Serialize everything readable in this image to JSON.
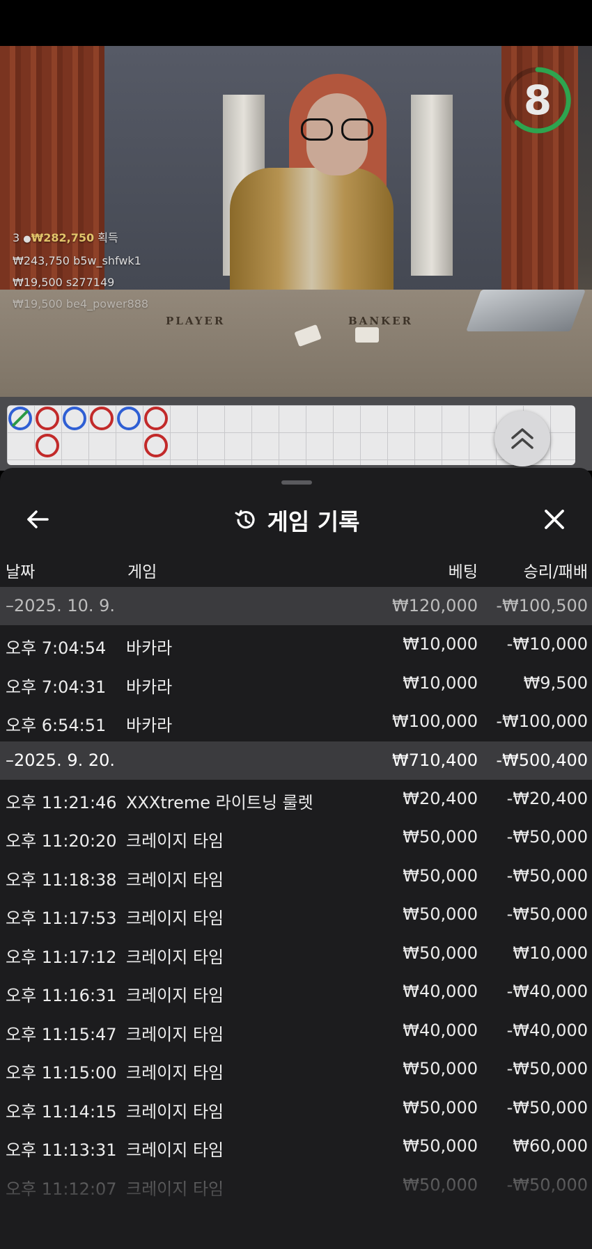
{
  "stream": {
    "timer_value": "8",
    "table_labels": {
      "player": "PLAYER",
      "banker": "BANKER"
    },
    "winners": {
      "summary": {
        "count": "3",
        "amount": "₩282,750",
        "suffix": "획득"
      },
      "entries": [
        {
          "amount": "₩243,750",
          "user": "b5w_shfwk1"
        },
        {
          "amount": "₩19,500",
          "user": "s277149"
        },
        {
          "amount": "₩19,500",
          "user": "be4_power888"
        }
      ]
    }
  },
  "roadmap": {
    "beads": [
      {
        "color": "blue",
        "col": 0,
        "row": 0,
        "marked": true
      },
      {
        "color": "red",
        "col": 1,
        "row": 0,
        "marked": false
      },
      {
        "color": "red",
        "col": 1,
        "row": 1,
        "marked": false
      },
      {
        "color": "blue",
        "col": 2,
        "row": 0,
        "marked": false
      },
      {
        "color": "red",
        "col": 3,
        "row": 0,
        "marked": false
      },
      {
        "color": "blue",
        "col": 4,
        "row": 0,
        "marked": false
      },
      {
        "color": "red",
        "col": 5,
        "row": 0,
        "marked": false
      },
      {
        "color": "red",
        "col": 5,
        "row": 1,
        "marked": false
      }
    ],
    "expand_icon": "double-chevron-up-icon"
  },
  "sheet": {
    "title": "게임 기록",
    "title_icon": "history-icon",
    "back_icon": "arrow-left-icon",
    "close_icon": "close-icon",
    "columns": {
      "date": "날짜",
      "game": "게임",
      "bet": "베팅",
      "result": "승리/패배"
    },
    "rows": [
      {
        "type": "group",
        "date": "–2025. 10. 9.",
        "game": "",
        "bet": "₩120,000",
        "result": "-₩100,500"
      },
      {
        "type": "item",
        "date": "오후 7:04:54",
        "game": "바카라",
        "bet": "₩10,000",
        "result": "-₩10,000"
      },
      {
        "type": "item",
        "date": "오후 7:04:31",
        "game": "바카라",
        "bet": "₩10,000",
        "result": "₩9,500"
      },
      {
        "type": "item",
        "date": "오후 6:54:51",
        "game": "바카라",
        "bet": "₩100,000",
        "result": "-₩100,000"
      },
      {
        "type": "group",
        "date": "–2025. 9. 20.",
        "game": "",
        "bet": "₩710,400",
        "result": "-₩500,400"
      },
      {
        "type": "item",
        "date": "오후 11:21:46",
        "game": "XXXtreme 라이트닝 룰렛",
        "bet": "₩20,400",
        "result": "-₩20,400"
      },
      {
        "type": "item",
        "date": "오후 11:20:20",
        "game": "크레이지 타임",
        "bet": "₩50,000",
        "result": "-₩50,000"
      },
      {
        "type": "item",
        "date": "오후 11:18:38",
        "game": "크레이지 타임",
        "bet": "₩50,000",
        "result": "-₩50,000"
      },
      {
        "type": "item",
        "date": "오후 11:17:53",
        "game": "크레이지 타임",
        "bet": "₩50,000",
        "result": "-₩50,000"
      },
      {
        "type": "item",
        "date": "오후 11:17:12",
        "game": "크레이지 타임",
        "bet": "₩50,000",
        "result": "₩10,000"
      },
      {
        "type": "item",
        "date": "오후 11:16:31",
        "game": "크레이지 타임",
        "bet": "₩40,000",
        "result": "-₩40,000"
      },
      {
        "type": "item",
        "date": "오후 11:15:47",
        "game": "크레이지 타임",
        "bet": "₩40,000",
        "result": "-₩40,000"
      },
      {
        "type": "item",
        "date": "오후 11:15:00",
        "game": "크레이지 타임",
        "bet": "₩50,000",
        "result": "-₩50,000"
      },
      {
        "type": "item",
        "date": "오후 11:14:15",
        "game": "크레이지 타임",
        "bet": "₩50,000",
        "result": "-₩50,000"
      },
      {
        "type": "item",
        "date": "오후 11:13:31",
        "game": "크레이지 타임",
        "bet": "₩50,000",
        "result": "₩60,000"
      },
      {
        "type": "item",
        "date": "오후 11:12:07",
        "game": "크레이지 타임",
        "bet": "₩50,000",
        "result": "-₩50,000"
      }
    ]
  },
  "colors": {
    "sheet_bg": "#1c1c1e",
    "group_row_bg": "#3b3b3e",
    "timer_ring": "#2ea44f",
    "bead_red": "#c22a2a",
    "bead_blue": "#2f5fd4",
    "winner_gold": "#e2c46a"
  }
}
